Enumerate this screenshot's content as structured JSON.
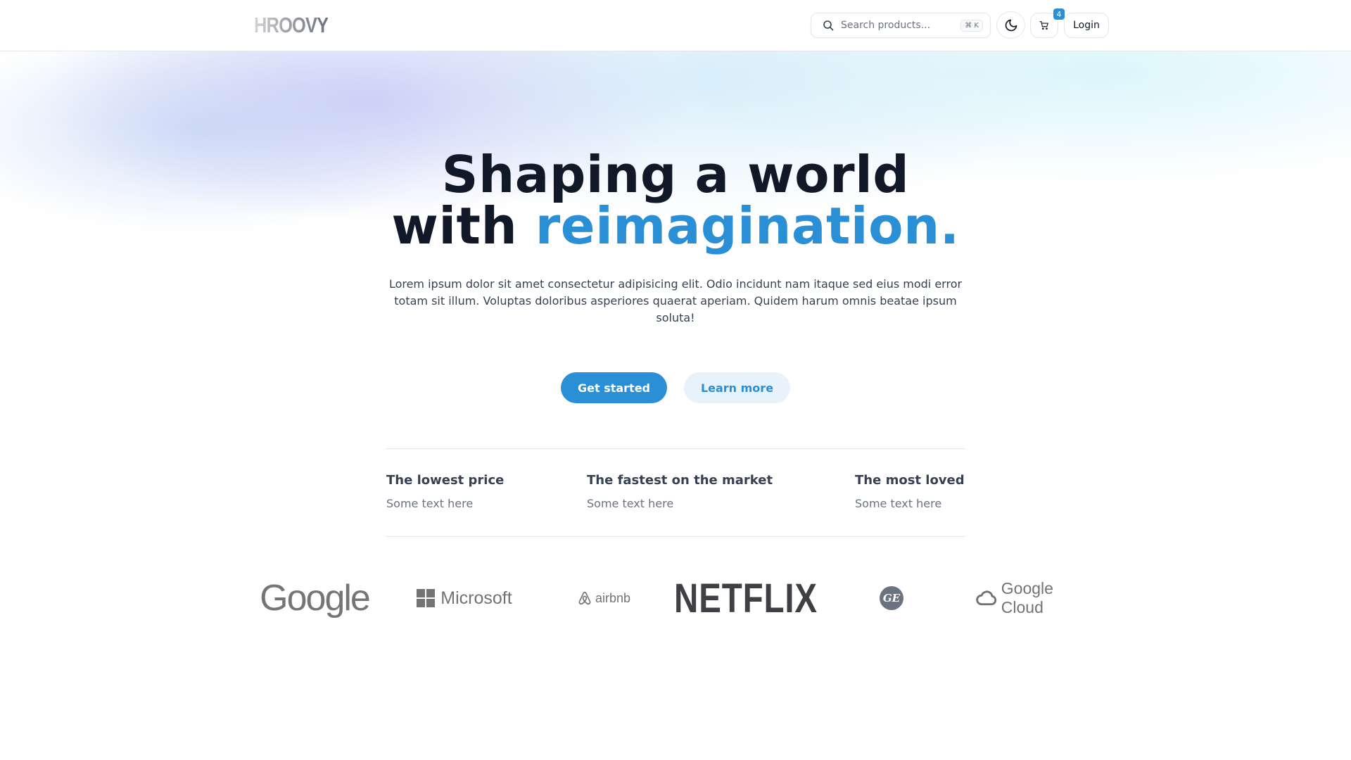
{
  "header": {
    "logo_text": "HROOVY",
    "search": {
      "placeholder": "Search products...",
      "shortcut": "⌘ K",
      "icon": "search-icon"
    },
    "theme_toggle_icon": "moon-icon",
    "cart": {
      "icon": "cart-icon",
      "count": "4"
    },
    "login_label": "Login"
  },
  "hero": {
    "headline_line1": "Shaping a world",
    "headline_with": "with ",
    "headline_accent": "reimagination.",
    "description": "Lorem ipsum dolor sit amet consectetur adipisicing elit. Odio incidunt nam itaque sed eius modi error totam sit illum. Voluptas doloribus asperiores quaerat aperiam. Quidem harum omnis beatae ipsum soluta!",
    "primary_cta": "Get started",
    "secondary_cta": "Learn more"
  },
  "features": [
    {
      "title": "The lowest price",
      "text": "Some text here"
    },
    {
      "title": "The fastest on the market",
      "text": "Some text here"
    },
    {
      "title": "The most loved",
      "text": "Some text here"
    }
  ],
  "logos": {
    "google": "Google",
    "microsoft": "Microsoft",
    "airbnb": "airbnb",
    "netflix": "NETFLIX",
    "ge": "GE",
    "google_cloud": "Google Cloud"
  },
  "colors": {
    "accent": "#2b8fd6",
    "heading": "#111827",
    "body_text": "#374151",
    "muted_text": "#6b7280",
    "secondary_button_bg": "#e8f2fb",
    "border": "#e5e7eb"
  }
}
